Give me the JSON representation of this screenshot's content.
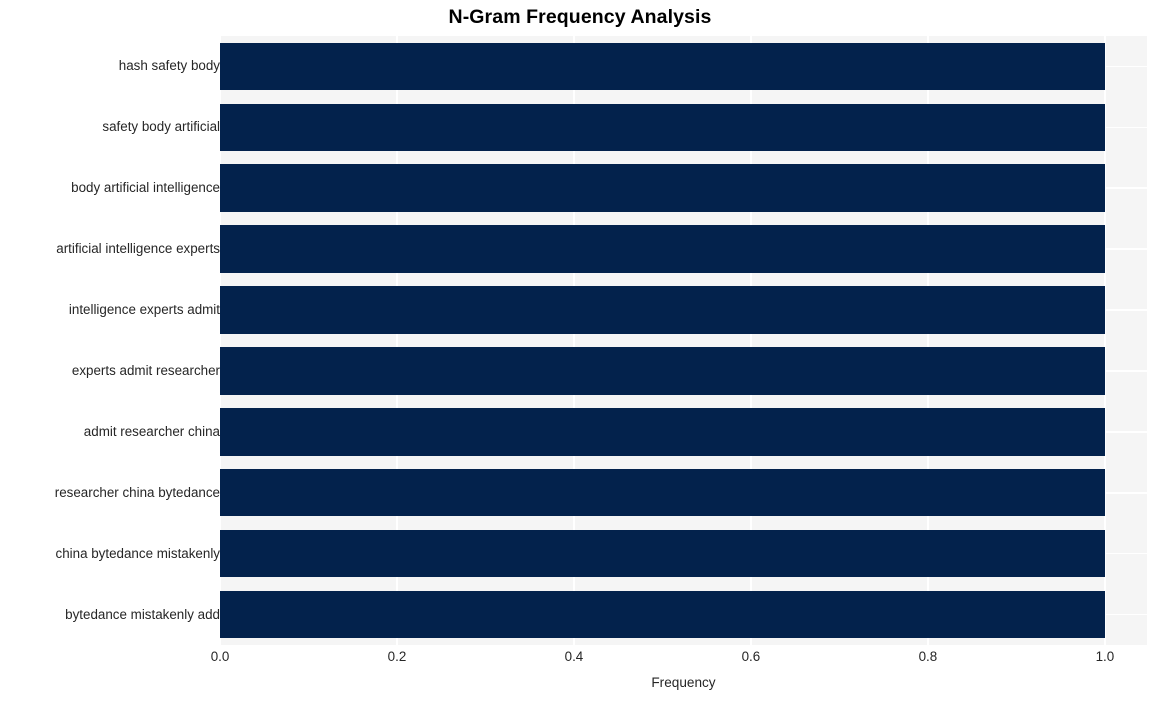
{
  "chart_data": {
    "type": "bar",
    "orientation": "horizontal",
    "title": "N-Gram Frequency Analysis",
    "xlabel": "Frequency",
    "ylabel": "",
    "categories": [
      "hash safety body",
      "safety body artificial",
      "body artificial intelligence",
      "artificial intelligence experts",
      "intelligence experts admit",
      "experts admit researcher",
      "admit researcher china",
      "researcher china bytedance",
      "china bytedance mistakenly",
      "bytedance mistakenly add"
    ],
    "values": [
      1.0,
      1.0,
      1.0,
      1.0,
      1.0,
      1.0,
      1.0,
      1.0,
      1.0,
      1.0
    ],
    "xticks": [
      "0.0",
      "0.2",
      "0.4",
      "0.6",
      "0.8",
      "1.0"
    ],
    "xtick_values": [
      0.0,
      0.2,
      0.4,
      0.6,
      0.8,
      1.0
    ],
    "xlim": [
      0.0,
      1.0476
    ],
    "grid": true,
    "legend": null,
    "bar_color": "#03224c",
    "plot_background": "#f5f5f5",
    "grid_color": "#ffffff",
    "figure_background": "#ffffff",
    "text_color": "#262626"
  }
}
